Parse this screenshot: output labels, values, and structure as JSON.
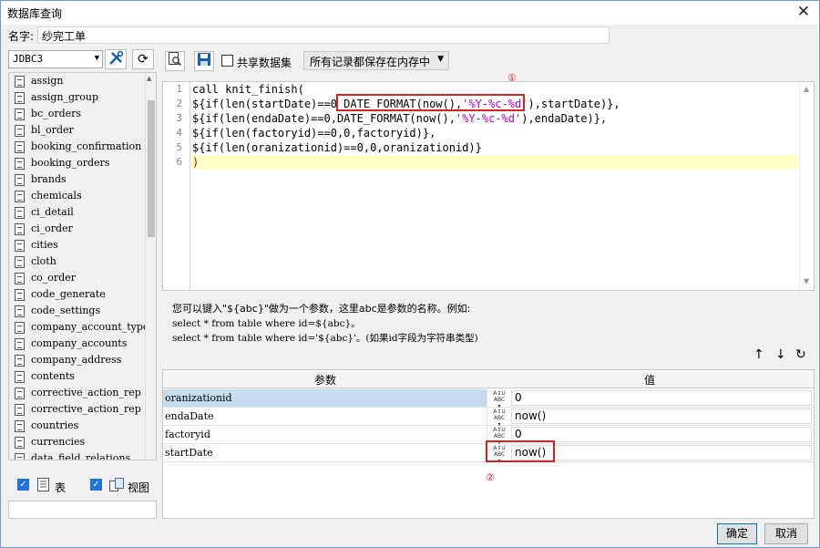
{
  "window": {
    "title": "数据库查询",
    "close": "✕"
  },
  "name_row": {
    "label": "名字:",
    "value": "纱完工单"
  },
  "left": {
    "connection": "JDBC3",
    "tables": [
      "assign",
      "assign_group",
      "bc_orders",
      "bl_order",
      "booking_confirmation",
      "booking_orders",
      "brands",
      "chemicals",
      "ci_detail",
      "ci_order",
      "cities",
      "cloth",
      "co_order",
      "code_generate",
      "code_settings",
      "company_account_types",
      "company_accounts",
      "company_address",
      "contents",
      "corrective_action_rep",
      "corrective_action_rep",
      "countries",
      "currencies",
      "data_field_relations"
    ],
    "table_label": "表",
    "view_label": "视图"
  },
  "right": {
    "share_label": "共享数据集",
    "save_mode": "所有记录都保存在内存中",
    "sql_lines": [
      "call knit_finish(",
      "${if(len(startDate)==0 DATE_FORMAT(now(),'%Y-%c-%d'),startDate)},",
      "${if(len(endaDate)==0,DATE_FORMAT(now(),'%Y-%c-%d'),endaDate)},",
      "${if(len(factoryid)==0,0,factoryid)},",
      "${if(len(oranizationid)==0,0,oranizationid)}",
      ")"
    ],
    "line_numbers": [
      "1",
      "2",
      "3",
      "4",
      "5",
      "6"
    ],
    "marker1": "①",
    "marker2": "②",
    "help_line1": "您可以键入\"${abc}\"做为一个参数，这里abc是参数的名称。例如:",
    "help_line2": "select * from table where id=${abc}。",
    "help_line3": "select * from table where id='${abc}'。(如果id字段为字符串类型)",
    "grid_header_param": "参数",
    "grid_header_value": "值",
    "params": [
      {
        "name": "oranizationid",
        "value": "0"
      },
      {
        "name": "endaDate",
        "value": "now()"
      },
      {
        "name": "factoryid",
        "value": "0"
      },
      {
        "name": "startDate",
        "value": "now()"
      }
    ]
  },
  "buttons": {
    "ok": "确定",
    "cancel": "取消"
  }
}
